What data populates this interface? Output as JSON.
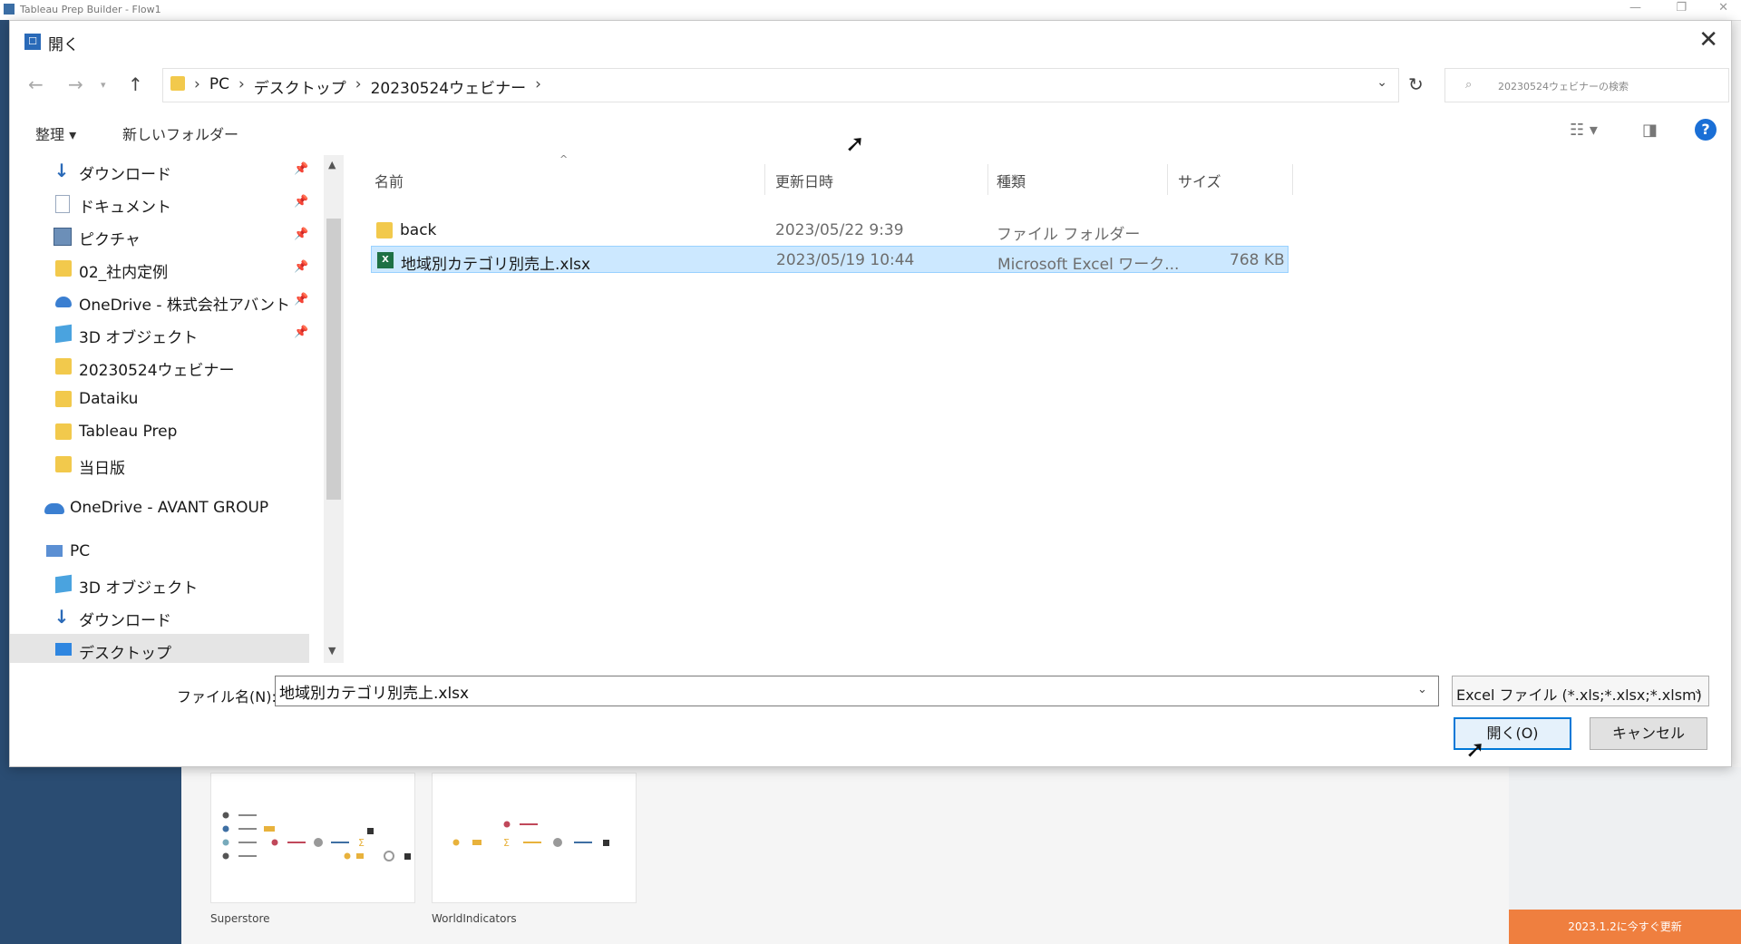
{
  "app": {
    "window_title": "Tableau Prep Builder - Flow1",
    "samples": [
      {
        "label": "Superstore"
      },
      {
        "label": "WorldIndicators"
      }
    ],
    "update_banner": "2023.1.2に今すぐ更新"
  },
  "dialog": {
    "title": "開く",
    "address": {
      "crumbs": [
        "PC",
        "デスクトップ",
        "20230524ウェビナー"
      ],
      "search_placeholder": "20230524ウェビナーの検索"
    },
    "toolbar": {
      "organize": "整理 ▾",
      "new_folder": "新しいフォルダー",
      "help": "?"
    },
    "nav": {
      "quick_access": [
        {
          "label": "ダウンロード",
          "icon": "download-icon",
          "pinned": true
        },
        {
          "label": "ドキュメント",
          "icon": "document-icon",
          "pinned": true
        },
        {
          "label": "ピクチャ",
          "icon": "pictures-icon",
          "pinned": true
        },
        {
          "label": "02_社内定例",
          "icon": "folder-icon",
          "pinned": true
        },
        {
          "label": "OneDrive - 株式会社アバント",
          "icon": "onedrive-icon",
          "pinned": true
        },
        {
          "label": "3D オブジェクト",
          "icon": "3d-objects-icon",
          "pinned": true
        },
        {
          "label": "20230524ウェビナー",
          "icon": "folder-icon",
          "pinned": false
        },
        {
          "label": "Dataiku",
          "icon": "folder-icon",
          "pinned": false
        },
        {
          "label": "Tableau Prep",
          "icon": "folder-icon",
          "pinned": false
        },
        {
          "label": "当日版",
          "icon": "folder-icon",
          "pinned": false
        }
      ],
      "onedrive": "OneDrive - AVANT GROUP",
      "pc": "PC",
      "pc_items": [
        {
          "label": "3D オブジェクト",
          "icon": "3d-objects-icon"
        },
        {
          "label": "ダウンロード",
          "icon": "download-icon"
        },
        {
          "label": "デスクトップ",
          "icon": "desktop-icon",
          "selected": true
        }
      ]
    },
    "columns": {
      "name": "名前",
      "modified": "更新日時",
      "type": "種類",
      "size": "サイズ"
    },
    "files": [
      {
        "name": "back",
        "modified": "2023/05/22 9:39",
        "type": "ファイル フォルダー",
        "size": "",
        "icon": "folder-icon",
        "selected": false
      },
      {
        "name": "地域別カテゴリ別売上.xlsx",
        "modified": "2023/05/19 10:44",
        "type": "Microsoft Excel ワーク...",
        "size": "768 KB",
        "icon": "excel-icon",
        "selected": true
      }
    ],
    "filename_label": "ファイル名(N):",
    "filename_value": "地域別カテゴリ別売上.xlsx",
    "filter_value": "Excel ファイル (*.xls;*.xlsx;*.xlsm)",
    "open_button": "開く(O)",
    "cancel_button": "キャンセル"
  }
}
